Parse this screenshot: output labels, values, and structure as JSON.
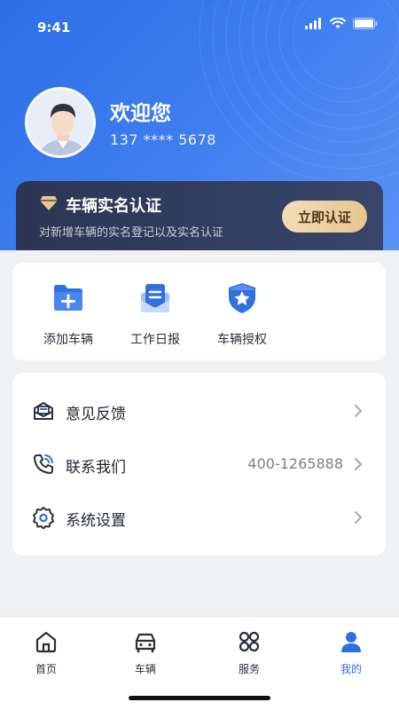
{
  "status_bar": {
    "time": "9:41"
  },
  "profile": {
    "greeting": "欢迎您",
    "phone": "137 **** 5678"
  },
  "certification": {
    "title": "车辆实名认证",
    "subtitle": "对新增车辆的实名登记以及实名认证",
    "button_label": "立即认证"
  },
  "quick_actions": [
    {
      "label": "添加车辆",
      "icon": "folder-add-icon"
    },
    {
      "label": "工作日报",
      "icon": "report-icon"
    },
    {
      "label": "车辆授权",
      "icon": "shield-star-icon"
    }
  ],
  "menu": [
    {
      "label": "意见反馈",
      "value": "",
      "icon": "feedback-icon"
    },
    {
      "label": "联系我们",
      "value": "400-1265888",
      "icon": "phone-icon"
    },
    {
      "label": "系统设置",
      "value": "",
      "icon": "settings-icon"
    }
  ],
  "tabs": [
    {
      "label": "首页",
      "icon": "home-icon",
      "active": false
    },
    {
      "label": "车辆",
      "icon": "car-icon",
      "active": false
    },
    {
      "label": "服务",
      "icon": "grid-icon",
      "active": false
    },
    {
      "label": "我的",
      "icon": "user-icon",
      "active": true
    }
  ],
  "colors": {
    "primary": "#2f6fe6",
    "gold": "#e8c690",
    "card_dark": "#2c3553"
  }
}
